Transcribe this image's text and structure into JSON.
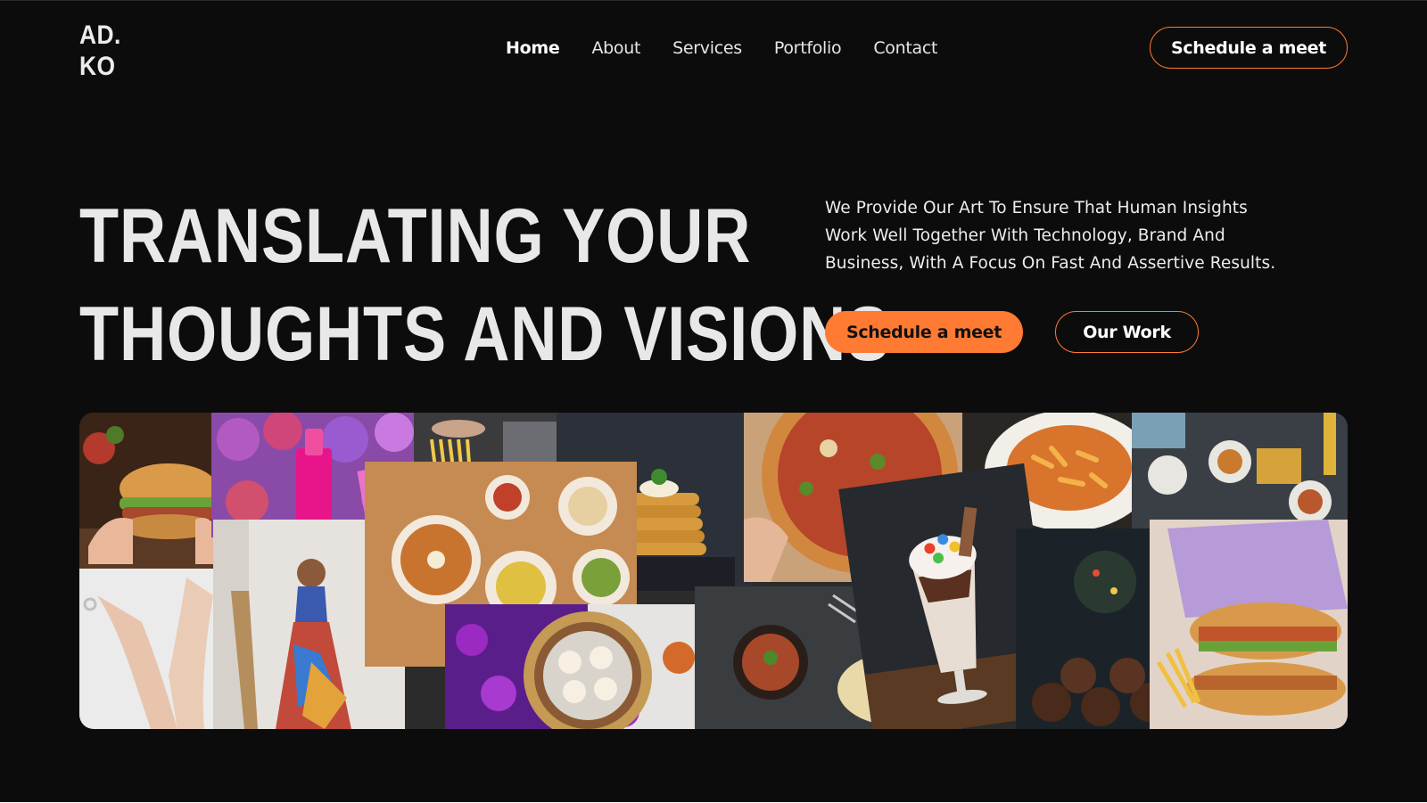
{
  "brand": {
    "line1": "AD.",
    "line2": "KO"
  },
  "nav": {
    "items": [
      {
        "label": "Home",
        "active": true
      },
      {
        "label": "About"
      },
      {
        "label": "Services"
      },
      {
        "label": "Portfolio"
      },
      {
        "label": "Contact"
      }
    ]
  },
  "header": {
    "cta_label": "Schedule a meet"
  },
  "hero": {
    "headline_line1": "TRANSLATING YOUR",
    "headline_line2": "THOUGHTS AND VISIONS",
    "description": "We Provide Our Art To Ensure That Human Insights Work Well Together With Technology, Brand And Business, With A Focus On Fast And Assertive Results.",
    "primary_cta": "Schedule a meet",
    "secondary_cta": "Our Work"
  },
  "colors": {
    "background": "#0c0c0c",
    "accent": "#ff7a33",
    "text": "#e8e8e8"
  },
  "collage": {
    "tiles": [
      "burger",
      "lipstick-flowers",
      "pasta-making",
      "pancake-stack",
      "pizza",
      "pasta-bowl",
      "restaurant-table",
      "hands-jewelry",
      "fashion-model",
      "food-spread",
      "flower-dessert-plate",
      "milkshake",
      "soup-and-naan",
      "cupcakes",
      "sandwich"
    ]
  }
}
